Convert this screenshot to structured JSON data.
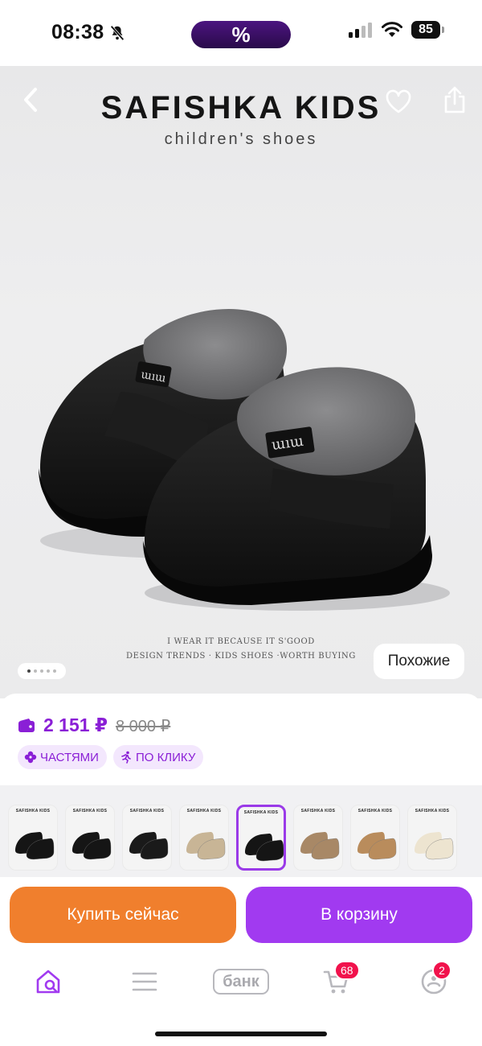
{
  "status_bar": {
    "time": "08:38",
    "promo_symbol": "%",
    "battery": "85"
  },
  "hero": {
    "brand_title": "SAFISHKA KIDS",
    "brand_subtitle": "children's shoes",
    "tagline_line1": "I WEAR IT BECAUSE IT S'GOOD",
    "tagline_line2": "DESIGN TRENDS    · KIDS SHOES   ·WORTH BUYING",
    "similar_label": "Похожие",
    "carousel": {
      "total": 5,
      "active": 1
    }
  },
  "price": {
    "current": "2 151 ₽",
    "old": "8 000 ₽",
    "badge_installments": "ЧАСТЯМИ",
    "badge_one_click": "ПО КЛИКУ"
  },
  "variants": [
    {
      "label": "SAFISHKA KIDS",
      "shoe_color": "#151515",
      "selected": false
    },
    {
      "label": "SAFISHKA KIDS",
      "shoe_color": "#151515",
      "selected": false
    },
    {
      "label": "SAFISHKA KIDS",
      "shoe_color": "#1a1a1a",
      "selected": false
    },
    {
      "label": "SAFISHKA KIDS",
      "shoe_color": "#c8b596",
      "selected": false
    },
    {
      "label": "SAFISHKA KIDS",
      "shoe_color": "#151515",
      "selected": true
    },
    {
      "label": "SAFISHKA KIDS",
      "shoe_color": "#a88866",
      "selected": false
    },
    {
      "label": "SAFISHKA KIDS",
      "shoe_color": "#b98c5c",
      "selected": false
    },
    {
      "label": "SAFISHKA KIDS",
      "shoe_color": "#ede4d0",
      "selected": false
    }
  ],
  "actions": {
    "buy_now": "Купить сейчас",
    "add_to_cart": "В корзину"
  },
  "nav": {
    "bank_label": "банк",
    "cart_count": "68",
    "profile_count": "2"
  },
  "colors": {
    "accent": "#a13af0",
    "buy_now": "#f07f2d",
    "price": "#8a1fd6",
    "badge_red": "#f1124c"
  }
}
